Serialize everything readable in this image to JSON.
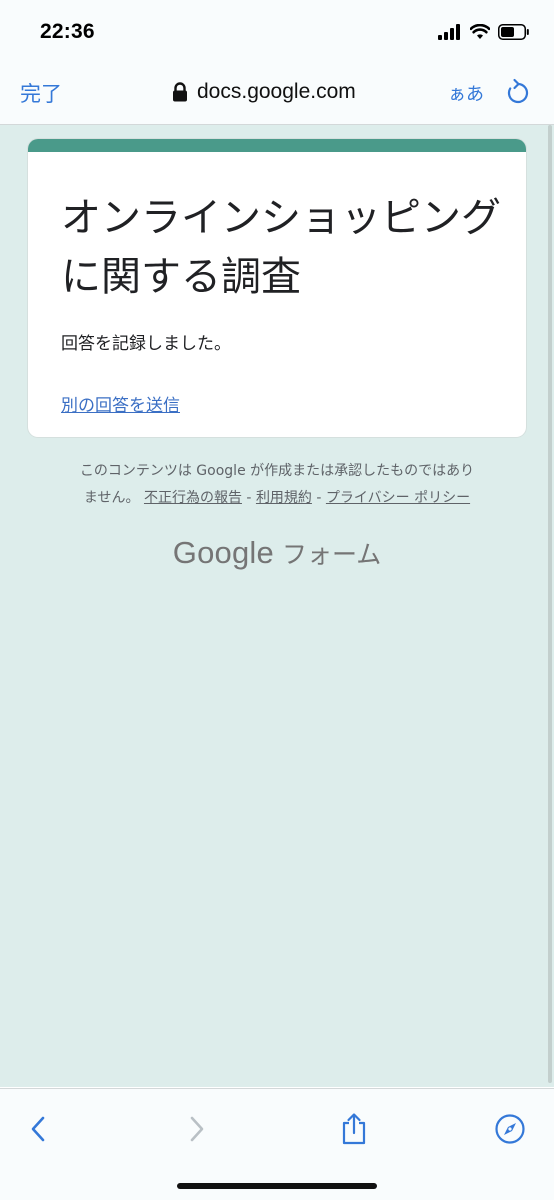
{
  "status_bar": {
    "time": "22:36"
  },
  "browser": {
    "done_label": "完了",
    "url": "docs.google.com",
    "text_size_label": "ぁあ"
  },
  "form": {
    "title": "オンラインショッピングに関する調査",
    "confirmation": "回答を記録しました。",
    "another_response_link": "別の回答を送信",
    "accent_color": "#4a9a8a",
    "background_color": "#ddedeb"
  },
  "footer": {
    "disclaimer_line1": "このコンテンツは Google が作成または承認したものではあり",
    "disclaimer_line2_prefix": "ません。",
    "links": [
      "不正行為の報告",
      "利用規約",
      "プライバシー ポリシー"
    ],
    "separator": "-",
    "logo_google": "Google",
    "logo_forms": "フォーム"
  },
  "toolbar": {
    "icons": [
      "back-icon",
      "forward-icon",
      "share-icon",
      "compass-icon"
    ]
  }
}
